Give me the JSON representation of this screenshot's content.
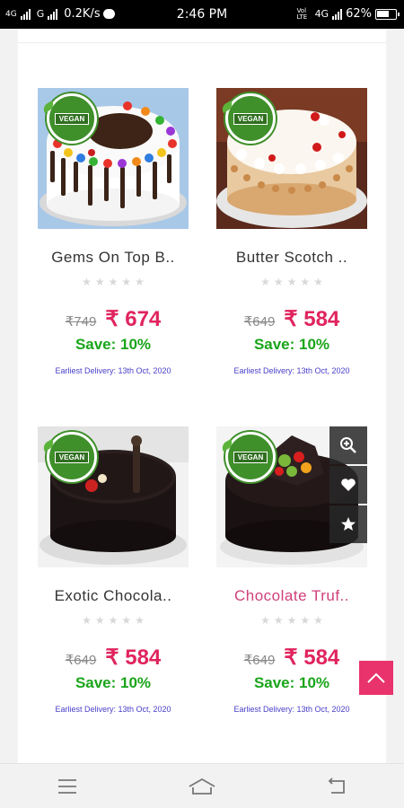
{
  "status_bar": {
    "network_1": "4G",
    "network_2": "G",
    "speed": "0.2K/s",
    "time": "2:46 PM",
    "volte": "Vol LTE",
    "network_3": "4G",
    "battery": "62%"
  },
  "products": [
    {
      "name": "Gems On Top B..",
      "old_price": "₹749",
      "new_price": "₹ 674",
      "save": "Save: 10%",
      "delivery": "Earliest Delivery: 13th Oct, 2020",
      "badge": "VEGAN"
    },
    {
      "name": "Butter Scotch ..",
      "old_price": "₹649",
      "new_price": "₹ 584",
      "save": "Save: 10%",
      "delivery": "Earliest Delivery: 13th Oct, 2020",
      "badge": "VEGAN"
    },
    {
      "name": "Exotic Chocola..",
      "old_price": "₹649",
      "new_price": "₹ 584",
      "save": "Save: 10%",
      "delivery": "Earliest Delivery: 13th Oct, 2020",
      "badge": "VEGAN"
    },
    {
      "name": "Chocolate Truf..",
      "old_price": "₹649",
      "new_price": "₹ 584",
      "save": "Save: 10%",
      "delivery": "Earliest Delivery: 13th Oct, 2020",
      "badge": "VEGAN"
    }
  ],
  "icons": {
    "zoom": "zoom-in-icon",
    "wishlist": "heart-icon",
    "favorite": "star-icon",
    "scroll_top": "chevron-up-icon",
    "nav_menu": "menu-icon",
    "nav_home": "home-icon",
    "nav_back": "back-icon"
  },
  "colors": {
    "accent": "#e0245e",
    "save": "#1aa51a",
    "delivery": "#4a40c8",
    "vegan": "#3f8f2a"
  }
}
